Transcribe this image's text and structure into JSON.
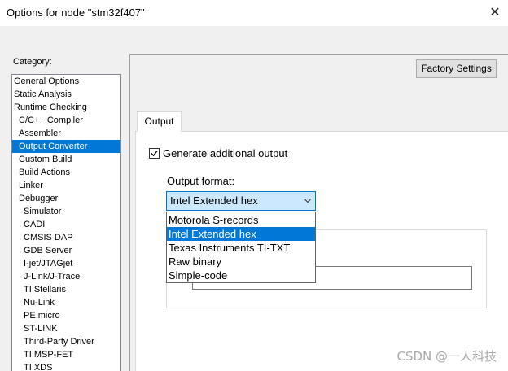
{
  "window": {
    "title": "Options for node \"stm32f407\"",
    "close_glyph": "✕"
  },
  "sidebar": {
    "label": "Category:",
    "items": [
      {
        "label": "General Options",
        "level": 0
      },
      {
        "label": "Static Analysis",
        "level": 0
      },
      {
        "label": "Runtime Checking",
        "level": 0
      },
      {
        "label": "C/C++ Compiler",
        "level": 1
      },
      {
        "label": "Assembler",
        "level": 1
      },
      {
        "label": "Output Converter",
        "level": 1,
        "selected": true
      },
      {
        "label": "Custom Build",
        "level": 1
      },
      {
        "label": "Build Actions",
        "level": 1
      },
      {
        "label": "Linker",
        "level": 1
      },
      {
        "label": "Debugger",
        "level": 1
      },
      {
        "label": "Simulator",
        "level": 2
      },
      {
        "label": "CADI",
        "level": 2
      },
      {
        "label": "CMSIS DAP",
        "level": 2
      },
      {
        "label": "GDB Server",
        "level": 2
      },
      {
        "label": "I-jet/JTAGjet",
        "level": 2
      },
      {
        "label": "J-Link/J-Trace",
        "level": 2
      },
      {
        "label": "TI Stellaris",
        "level": 2
      },
      {
        "label": "Nu-Link",
        "level": 2
      },
      {
        "label": "PE micro",
        "level": 2
      },
      {
        "label": "ST-LINK",
        "level": 2
      },
      {
        "label": "Third-Party Driver",
        "level": 2
      },
      {
        "label": "TI MSP-FET",
        "level": 2
      },
      {
        "label": "TI XDS",
        "level": 2
      }
    ]
  },
  "toolbar": {
    "factory_settings_label": "Factory Settings"
  },
  "tabs": [
    {
      "label": "Output",
      "active": true
    }
  ],
  "output_tab": {
    "generate_checkbox_label": "Generate additional output",
    "generate_checked": true,
    "format_label": "Output format:",
    "selected_format": "Intel Extended hex",
    "format_options": [
      "Motorola S-records",
      "Intel Extended hex",
      "Texas Instruments TI-TXT",
      "Raw binary",
      "Simple-code"
    ],
    "highlighted_index": 1,
    "output_file_value": ""
  },
  "watermark": "CSDN @一人科技",
  "colors": {
    "accent": "#0078d7",
    "select_bg": "#cce8ff"
  }
}
